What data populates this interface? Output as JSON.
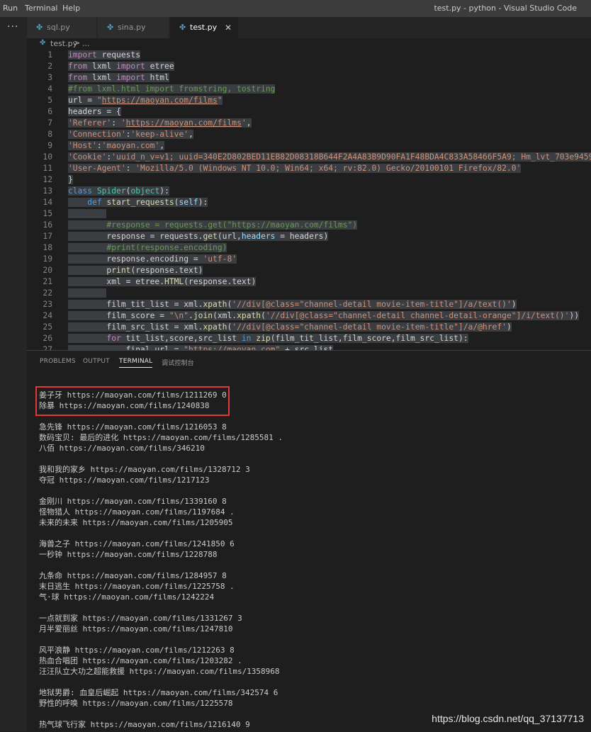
{
  "menu": {
    "items": [
      "Run",
      "Terminal",
      "Help"
    ]
  },
  "window_title": "test.py - python - Visual Studio Code",
  "sidebar": {
    "more_label": "···"
  },
  "tabs": [
    {
      "label": "sql.py",
      "active": false
    },
    {
      "label": "sina.py",
      "active": false
    },
    {
      "label": "test.py",
      "active": true
    }
  ],
  "breadcrumb": {
    "file": "test.py",
    "separator": ">",
    "more": "..."
  },
  "editor": {
    "line_numbers": [
      "1",
      "2",
      "3",
      "4",
      "5",
      "6",
      "7",
      "8",
      "9",
      "10",
      "11",
      "12",
      "13",
      "14",
      "15",
      "16",
      "17",
      "18",
      "19",
      "20",
      "21",
      "22",
      "23",
      "24",
      "25",
      "26",
      "27"
    ]
  },
  "panel": {
    "tabs": [
      "PROBLEMS",
      "OUTPUT",
      "TERMINAL",
      "调试控制台"
    ],
    "active_tab": "TERMINAL",
    "terminal_lines": [
      "姜子牙 https://maoyan.com/films/1211269 0",
      "除暴 https://maoyan.com/films/1240838",
      "",
      "急先锋 https://maoyan.com/films/1216053 8",
      "数码宝贝: 最后的进化 https://maoyan.com/films/1285581 .",
      "八佰 https://maoyan.com/films/346210",
      "",
      "我和我的家乡 https://maoyan.com/films/1328712 3",
      "夺冠 https://maoyan.com/films/1217123",
      "",
      "金刚川 https://maoyan.com/films/1339160 8",
      "怪物猎人 https://maoyan.com/films/1197684 .",
      "未来的未来 https://maoyan.com/films/1205905",
      "",
      "海兽之子 https://maoyan.com/films/1241850 6",
      "一秒钟 https://maoyan.com/films/1228788",
      "",
      "九条命 https://maoyan.com/films/1284957 8",
      "末日逃生 https://maoyan.com/films/1225758 .",
      "气·球 https://maoyan.com/films/1242224",
      "",
      "一点就到家 https://maoyan.com/films/1331267 3",
      "月半爱丽丝 https://maoyan.com/films/1247810",
      "",
      "风平浪静 https://maoyan.com/films/1212263 8",
      "热血合唱团 https://maoyan.com/films/1203282 .",
      "汪汪队立大功之超能救援 https://maoyan.com/films/1358968",
      "",
      "地狱男爵: 血皇后崛起 https://maoyan.com/films/342574 6",
      "野性的呼唤 https://maoyan.com/films/1225578",
      "",
      "热气球飞行家 https://maoyan.com/films/1216140 9"
    ]
  },
  "watermark": "https://blog.csdn.net/qq_37137713",
  "colors": {
    "keyword": "#569cd6",
    "string": "#ce9178",
    "comment": "#6a9955",
    "highlight_box": "#e53935"
  }
}
